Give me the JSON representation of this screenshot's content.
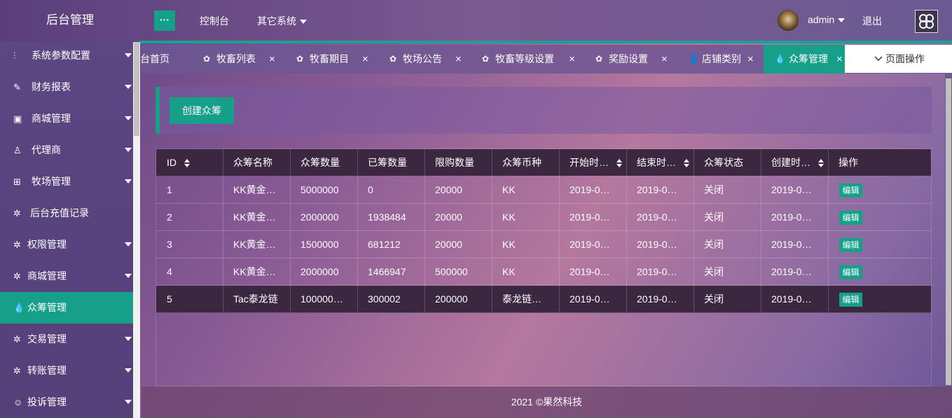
{
  "app": {
    "title": "后台管理"
  },
  "header": {
    "toggle": "···",
    "nav": [
      {
        "label": "控制台"
      },
      {
        "label": "其它系统"
      }
    ],
    "user": "admin",
    "logout": "退出"
  },
  "sidebar": {
    "items": [
      {
        "icon": "sliders-icon",
        "glyph": "⫶",
        "label": "系统参数配置"
      },
      {
        "icon": "chart-icon",
        "glyph": "✎",
        "label": "财务报表"
      },
      {
        "icon": "shop-icon",
        "glyph": "▣",
        "label": "商城管理"
      },
      {
        "icon": "user-icon",
        "glyph": "♙",
        "label": "代理商"
      },
      {
        "icon": "gift-icon",
        "glyph": "⊞",
        "label": "牧场管理"
      },
      {
        "icon": "gear-icon",
        "glyph": "✲",
        "label": "后台充值记录"
      },
      {
        "icon": "gear-icon",
        "glyph": "✲",
        "label": "权限管理"
      },
      {
        "icon": "gear-icon",
        "glyph": "✲",
        "label": "商城管理"
      },
      {
        "icon": "drops-icon",
        "glyph": "💧",
        "label": "众筹管理"
      },
      {
        "icon": "gear-icon",
        "glyph": "✲",
        "label": "交易管理"
      },
      {
        "icon": "gear-icon",
        "glyph": "✲",
        "label": "转账管理"
      },
      {
        "icon": "smile-icon",
        "glyph": "☺",
        "label": "投诉管理"
      }
    ],
    "active_index": 8
  },
  "tabs": [
    {
      "label": "台首页",
      "icon": ""
    },
    {
      "label": "牧畜列表",
      "icon": "✿"
    },
    {
      "label": "牧畜期目",
      "icon": "✿"
    },
    {
      "label": "牧场公告",
      "icon": "✿"
    },
    {
      "label": "牧畜等级设置",
      "icon": "✿"
    },
    {
      "label": "奖励设置",
      "icon": "✿"
    },
    {
      "label": "店铺类别",
      "icon": "👤"
    },
    {
      "label": "众筹管理",
      "icon": "💧"
    }
  ],
  "tab_close": "×",
  "page_ops": "页面操作",
  "toolbar": {
    "create_label": "创建众筹"
  },
  "table": {
    "headers": [
      "ID",
      "众筹名称",
      "众筹数量",
      "已筹数量",
      "限购数量",
      "众筹币种",
      "开始时…",
      "结束时…",
      "众筹状态",
      "创建时…",
      "操作"
    ],
    "rows": [
      [
        "1",
        "KK黄金…",
        "5000000",
        "0",
        "20000",
        "KK",
        "2019-0…",
        "2019-0…",
        "关闭",
        "2019-0…",
        "编辑"
      ],
      [
        "2",
        "KK黄金…",
        "2000000",
        "1938484",
        "20000",
        "KK",
        "2019-0…",
        "2019-0…",
        "关闭",
        "2019-0…",
        "编辑"
      ],
      [
        "3",
        "KK黄金…",
        "1500000",
        "681212",
        "20000",
        "KK",
        "2019-0…",
        "2019-0…",
        "关闭",
        "2019-0…",
        "编辑"
      ],
      [
        "4",
        "KK黄金…",
        "2000000",
        "1466947",
        "500000",
        "KK",
        "2019-0…",
        "2019-0…",
        "关闭",
        "2019-0…",
        "编辑"
      ],
      [
        "5",
        "Tac泰龙链",
        "100000…",
        "300002",
        "200000",
        "泰龙链…",
        "2019-0…",
        "2019-0…",
        "关闭",
        "2019-0…",
        "编辑"
      ]
    ]
  },
  "footer": {
    "text": "2021 ©果然科技"
  },
  "colors": {
    "accent": "#16a089",
    "header_dark": "#3b2840"
  }
}
